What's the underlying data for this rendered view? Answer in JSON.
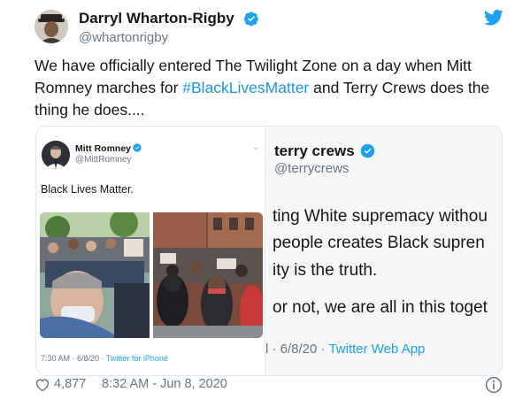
{
  "author": {
    "name": "Darryl Wharton-Rigby",
    "handle": "@whartonrigby"
  },
  "tweet": {
    "text_before": "We have officially entered The Twilight Zone on a day when Mitt Romney marches for ",
    "hashtag": "#BlackLivesMatter",
    "text_after": " and Terry Crews does the thing he does...."
  },
  "embedded_left": {
    "name": "Mitt Romney",
    "handle": "@MittRomney",
    "text": "Black Lives Matter.",
    "time": "7:30 AM · 6/8/20 · ",
    "source": "Twitter for iPhone"
  },
  "embedded_right": {
    "name": "terry crews",
    "handle": "@terrycrews",
    "lines": [
      "ting White supremacy withou",
      " people creates Black supren",
      "ity is the truth.",
      "or not, we are all in this toget"
    ],
    "time": "l · 6/8/20 · ",
    "source": "Twitter Web App"
  },
  "footer": {
    "likes": "4,877",
    "timestamp": "8:32 AM - Jun 8, 2020"
  },
  "colors": {
    "accent": "#1da1f2",
    "hashtag": "#1b95e0",
    "muted": "#657786"
  }
}
